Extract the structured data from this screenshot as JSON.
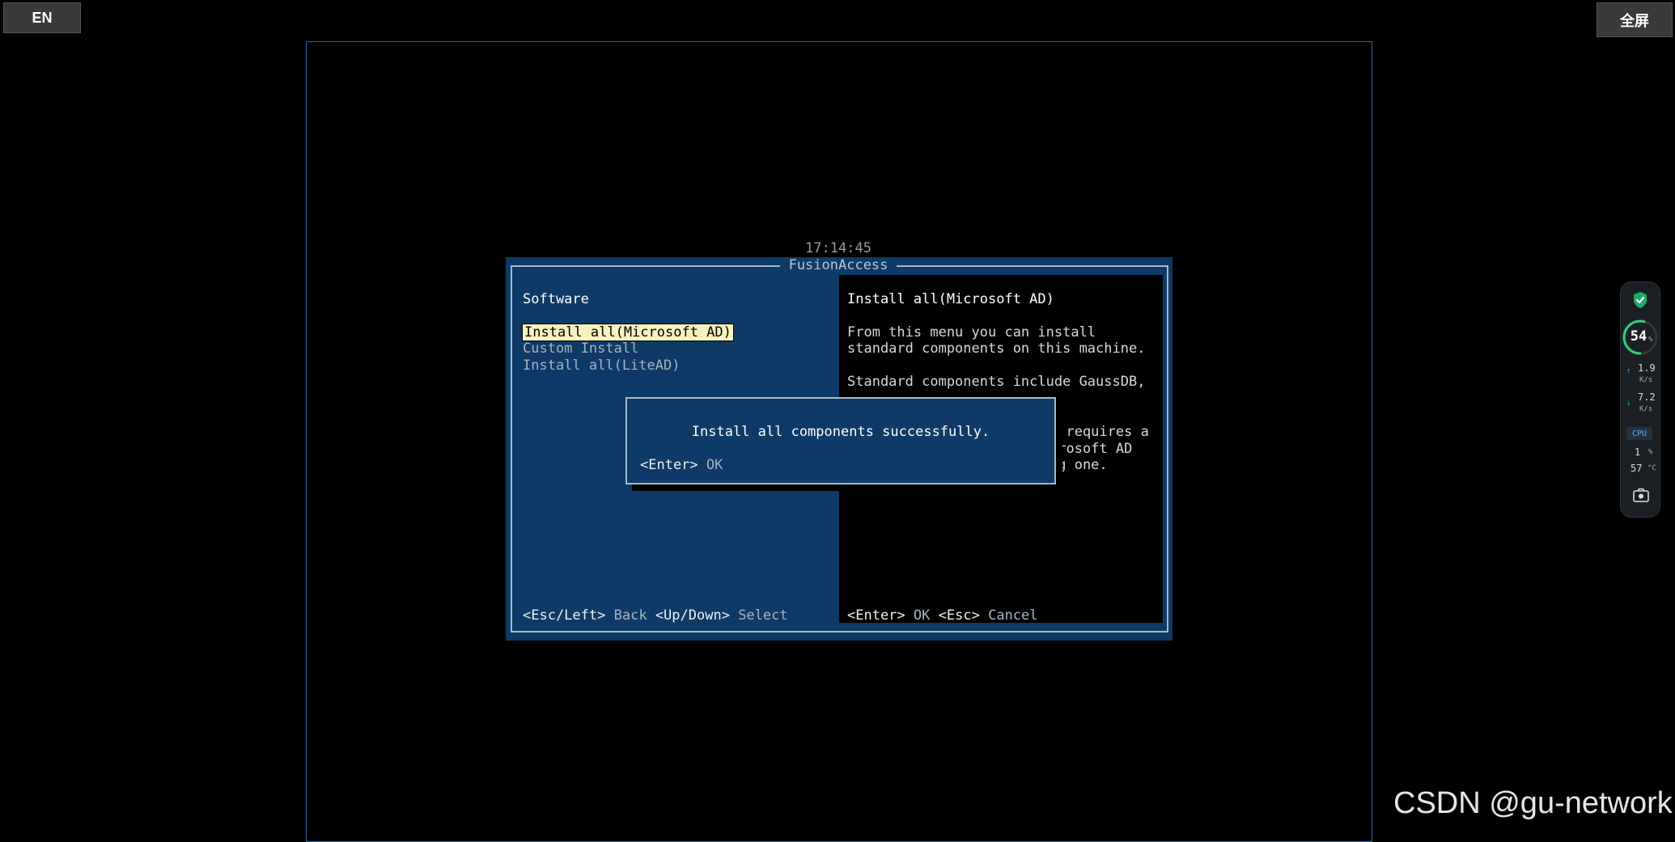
{
  "toolbar": {
    "lang_label": "EN",
    "fullscreen_label": "全屏"
  },
  "console": {
    "clock": "17:14:45",
    "title": "FusionAccess",
    "left_pane": {
      "heading": "Software",
      "menu": [
        "Install all(Microsoft AD)",
        "Custom Install",
        "Install all(LiteAD)"
      ],
      "selected_index": 0,
      "footer": {
        "k1": "<Esc/Left>",
        "a1": "Back",
        "k2": "<Up/Down>",
        "a2": "Select"
      }
    },
    "help_pane": {
      "title": "Install all(Microsoft AD)",
      "lines": [
        "From this menu you can install",
        "standard components on this machine.",
        "Standard components include GaussDB,",
        "n requires a",
        "crosoft AD",
        "ng one."
      ],
      "footer": {
        "k1": "<Enter>",
        "a1": "OK",
        "k2": "<Esc>",
        "a2": "Cancel"
      }
    },
    "message_box": {
      "text": "Install all components successfully.",
      "key": "<Enter>",
      "action": "OK"
    }
  },
  "monitor": {
    "gauge_value": "54",
    "gauge_unit": "%",
    "gauge_fraction": 0.54,
    "upload_value": "1.9",
    "upload_unit": "K/s",
    "download_value": "7.2",
    "download_unit": "K/s",
    "cpu_label": "CPU",
    "cpu_value": "1",
    "cpu_unit": "%",
    "temp_value": "57",
    "temp_unit": "°C",
    "colors": {
      "accent_green": "#27c07a",
      "accent_blue": "#3aa0ff"
    }
  },
  "watermark": "CSDN @gu-network"
}
